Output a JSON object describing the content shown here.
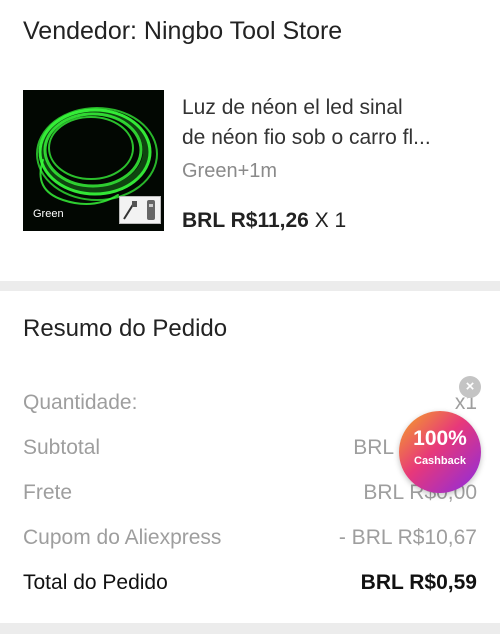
{
  "seller": {
    "title": "Vendedor: Ningbo Tool Store"
  },
  "product": {
    "image_caption": "Green",
    "title_line1": "Luz de néon el led sinal",
    "title_line2": "de néon fio sob o carro fl...",
    "variant": "Green+1m",
    "price": "BRL R$11,26",
    "quantity": "X 1"
  },
  "summary": {
    "title": "Resumo do Pedido",
    "rows": [
      {
        "label": "Quantidade:",
        "value": "x1"
      },
      {
        "label": "Subtotal",
        "value": "BRL R$11,26"
      },
      {
        "label": "Frete",
        "value": "BRL R$0,00"
      },
      {
        "label": "Cupom do Aliexpress",
        "value": "- BRL R$10,67"
      }
    ],
    "total": {
      "label": "Total do Pedido",
      "value": "BRL R$0,59"
    }
  },
  "cashback": {
    "percent": "100%",
    "label": "Cashback"
  },
  "colors": {
    "neon_green": "#39ff3c",
    "cashback_gradient": [
      "#f5a623",
      "#e7387a",
      "#8a2be2"
    ]
  }
}
